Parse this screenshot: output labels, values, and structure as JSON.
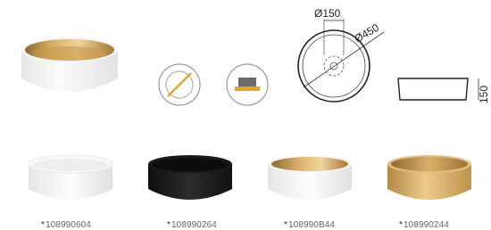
{
  "colors": {
    "gold": "#c99a4f",
    "gold_dark": "#a97a36",
    "gold_light": "#e8c888",
    "white_sink": "#f7f7f5",
    "black_sink": "#1c1c1c",
    "icon_orange": "#e8a227",
    "icon_gray": "#6b6b6b",
    "line": "#333333"
  },
  "icons": {
    "no_overflow": "no-overflow-icon",
    "countertop_mount": "countertop-mount-icon"
  },
  "dimensions": {
    "drain_diameter": "Ø150",
    "outer_diameter": "Ø450",
    "height": "150"
  },
  "variants": [
    {
      "marker": "*",
      "code": "108990604"
    },
    {
      "marker": "*",
      "code": "108990264"
    },
    {
      "marker": "*",
      "code": "108990B44"
    },
    {
      "marker": "*",
      "code": "108990244"
    }
  ]
}
